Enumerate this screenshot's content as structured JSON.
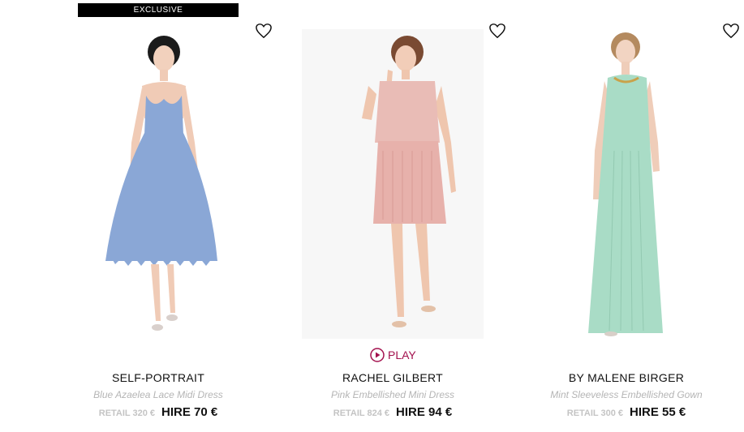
{
  "badge": "EXCLUSIVE",
  "products": [
    {
      "brand": "SELF-PORTRAIT",
      "name": "Blue Azaelea Lace Midi Dress",
      "retail": "RETAIL 320 €",
      "hire": "HIRE 70 €",
      "dress_color": "#8aa7d6",
      "photo_bg": "#ffffff"
    },
    {
      "brand": "RACHEL GILBERT",
      "name": "Pink Embellished Mini Dress",
      "retail": "RETAIL 824 €",
      "hire": "HIRE 94 €",
      "play_label": "PLAY",
      "dress_color": "#e7b9b3",
      "photo_bg": "#f7f7f7"
    },
    {
      "brand": "BY MALENE BIRGER",
      "name": "Mint Sleeveless Embellished Gown",
      "retail": "RETAIL 300 €",
      "hire": "HIRE 55 €",
      "dress_color": "#a9dcc6",
      "photo_bg": "#ffffff"
    }
  ],
  "colors": {
    "accent": "#a3114e",
    "muted": "#b5b5b5"
  },
  "icons": [
    "heart-icon",
    "play-icon"
  ]
}
